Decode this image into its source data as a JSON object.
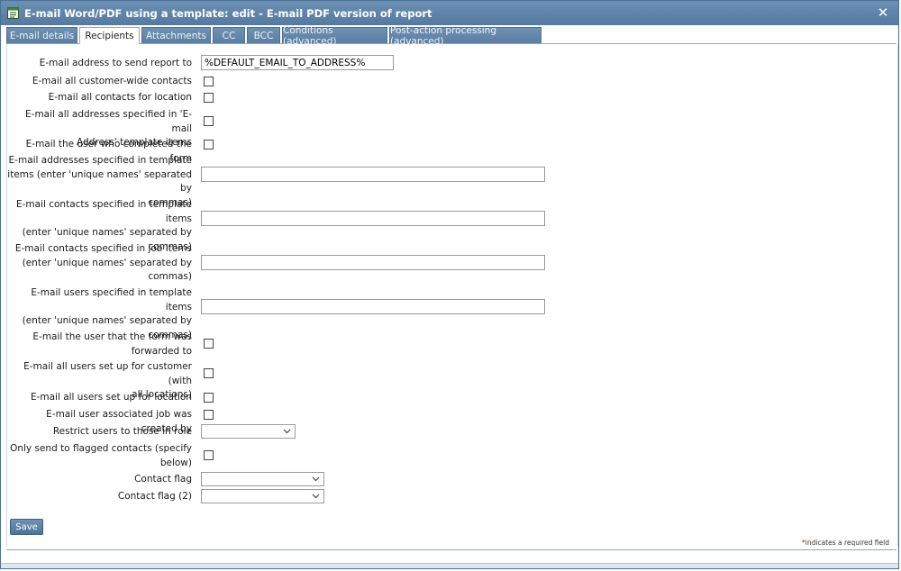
{
  "window": {
    "title": "E-mail Word/PDF using a template: edit - E-mail PDF version of report",
    "close_glyph": "✕"
  },
  "tabs": [
    {
      "label": "E-mail details"
    },
    {
      "label": "Recipients",
      "active": true
    },
    {
      "label": "Attachments"
    },
    {
      "label": "CC"
    },
    {
      "label": "BCC"
    },
    {
      "label": "Conditions (advanced)"
    },
    {
      "label": "Post-action processing (advanced)"
    }
  ],
  "form": {
    "email_address": {
      "label": "E-mail address to send report to",
      "value": "%DEFAULT_EMAIL_TO_ADDRESS%"
    },
    "customer_wide": {
      "label": "E-mail all customer-wide contacts",
      "checked": false
    },
    "location_contacts": {
      "label": "E-mail all contacts for location",
      "checked": false
    },
    "template_address_items": {
      "label_line1": "E-mail all addresses specified in 'E-mail",
      "label_line2": "Address' template items",
      "checked": false
    },
    "user_completed": {
      "label": "E-mail the user who completed the form",
      "checked": false
    },
    "addresses_template_items": {
      "label_line1": "E-mail addresses specified in template",
      "label_line2": "items (enter 'unique names' separated by",
      "label_line3": "commas)",
      "value": ""
    },
    "contacts_template_items": {
      "label_line1": "E-mail contacts specified in template items",
      "label_line2": "(enter 'unique names' separated by",
      "label_line3": "commas)",
      "value": ""
    },
    "contacts_job_items": {
      "label_line1": "E-mail contacts specified in job items",
      "label_line2": "(enter 'unique names' separated by",
      "label_line3": "commas)",
      "value": ""
    },
    "users_template_items": {
      "label_line1": "E-mail users specified in template items",
      "label_line2": "(enter 'unique names' separated by",
      "label_line3": "commas)",
      "value": ""
    },
    "user_forwarded": {
      "label_line1": "E-mail the user that the form was",
      "label_line2": "forwarded to",
      "checked": false
    },
    "users_customer": {
      "label_line1": "E-mail all users set up for customer (with",
      "label_line2": "all locations)",
      "checked": false
    },
    "users_location": {
      "label": "E-mail all users set up for location",
      "checked": false
    },
    "user_job_created": {
      "label": "E-mail user associated job was created by",
      "checked": false
    },
    "restrict_role": {
      "label": "Restrict users to those in role",
      "selected": ""
    },
    "flagged_contacts": {
      "label_line1": "Only send to flagged contacts (specify",
      "label_line2": "below)",
      "checked": false
    },
    "contact_flag": {
      "label": "Contact flag",
      "selected": ""
    },
    "contact_flag_2": {
      "label": "Contact flag (2)",
      "selected": ""
    }
  },
  "footer": {
    "save_label": "Save",
    "required_star": "*",
    "required_text": "indicates a required field"
  },
  "colors": {
    "titlebar": "#557aa0",
    "tab_inactive": "#5a7da2",
    "required_star": "#cc0000"
  }
}
